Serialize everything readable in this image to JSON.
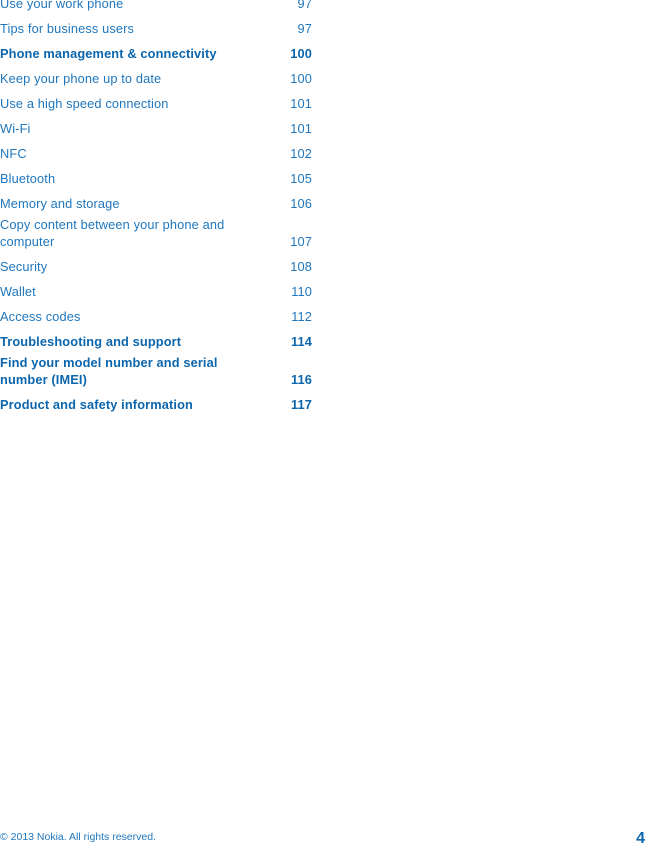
{
  "document": {
    "type": "table-of-contents",
    "text_color": "#2077bd",
    "heading_color": "#0c66ad",
    "background_color": "#ffffff"
  },
  "toc": {
    "entries": [
      {
        "title": "Use your work phone",
        "page": "97",
        "level": 2
      },
      {
        "title": "Tips for business users",
        "page": "97",
        "level": 2
      },
      {
        "title": "Phone management & connectivity",
        "page": "100",
        "level": 1
      },
      {
        "title": "Keep your phone up to date",
        "page": "100",
        "level": 2
      },
      {
        "title": "Use a high speed connection",
        "page": "101",
        "level": 2
      },
      {
        "title": "Wi-Fi",
        "page": "101",
        "level": 2
      },
      {
        "title": "NFC",
        "page": "102",
        "level": 2
      },
      {
        "title": "Bluetooth",
        "page": "105",
        "level": 2
      },
      {
        "title": "Memory and storage",
        "page": "106",
        "level": 2
      },
      {
        "title": "Copy content between your phone and computer",
        "page": "107",
        "level": 2
      },
      {
        "title": "Security",
        "page": "108",
        "level": 2
      },
      {
        "title": "Wallet",
        "page": "110",
        "level": 2
      },
      {
        "title": "Access codes",
        "page": "112",
        "level": 2
      },
      {
        "title": "Troubleshooting and support",
        "page": "114",
        "level": 1
      },
      {
        "title": "Find your model number and serial number (IMEI)",
        "page": "116",
        "level": 1
      },
      {
        "title": "Product and safety information",
        "page": "117",
        "level": 1
      }
    ]
  },
  "footer": {
    "copyright": "© 2013 Nokia. All rights reserved.",
    "page_number": "4"
  }
}
